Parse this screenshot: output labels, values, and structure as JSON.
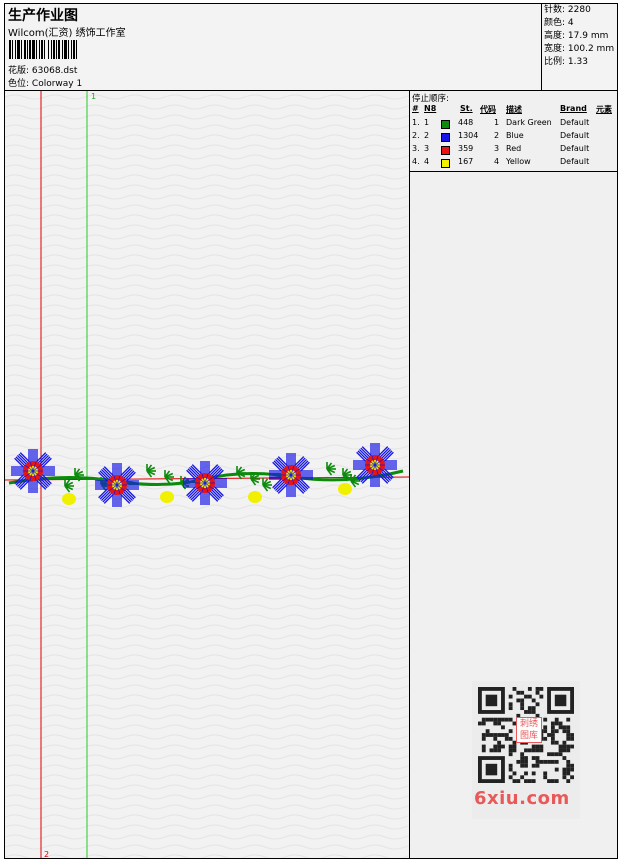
{
  "header": {
    "title": "生产作业图",
    "subtitle": "Wilcom(汇资) 绣饰工作室",
    "design_label": "花版:",
    "design_file": "63068.dst",
    "color_label": "色位:",
    "colorway": "Colorway 1"
  },
  "stats": [
    {
      "label": "针数:",
      "value": "2280"
    },
    {
      "label": "颜色:",
      "value": "4"
    },
    {
      "label": "高度:",
      "value": "17.9 mm"
    },
    {
      "label": "宽度:",
      "value": "100.2 mm"
    },
    {
      "label": "比例:",
      "value": "1.33"
    }
  ],
  "stop_sequence": {
    "label": "停止顺序:",
    "headers": {
      "hash": "#",
      "no": "N8",
      "st": "St.",
      "code": "代码",
      "desc": "描述",
      "brand": "Brand",
      "element": "元素"
    },
    "rows": [
      {
        "idx": "1.",
        "no": "1",
        "color": "#0c8a0c",
        "stitches": "448",
        "code": "1",
        "desc": "Dark Green",
        "brand": "Default"
      },
      {
        "idx": "2.",
        "no": "2",
        "color": "#1414e6",
        "stitches": "1304",
        "code": "2",
        "desc": "Blue",
        "brand": "Default"
      },
      {
        "idx": "3.",
        "no": "3",
        "color": "#e61414",
        "stitches": "359",
        "code": "3",
        "desc": "Red",
        "brand": "Default"
      },
      {
        "idx": "4.",
        "no": "4",
        "color": "#f0f000",
        "stitches": "167",
        "code": "4",
        "desc": "Yellow",
        "brand": "Default"
      }
    ]
  },
  "guides": {
    "green_label": "1",
    "red_label": "2"
  },
  "watermark": {
    "text": "6xiu.com",
    "qr_stamp": "刺绣图库"
  },
  "colors": {
    "blue": "#1414e6",
    "red": "#e61414",
    "green": "#0c8a0c",
    "yellow": "#f0f000",
    "guide_green": "#22cc22",
    "guide_red": "#e00000"
  }
}
